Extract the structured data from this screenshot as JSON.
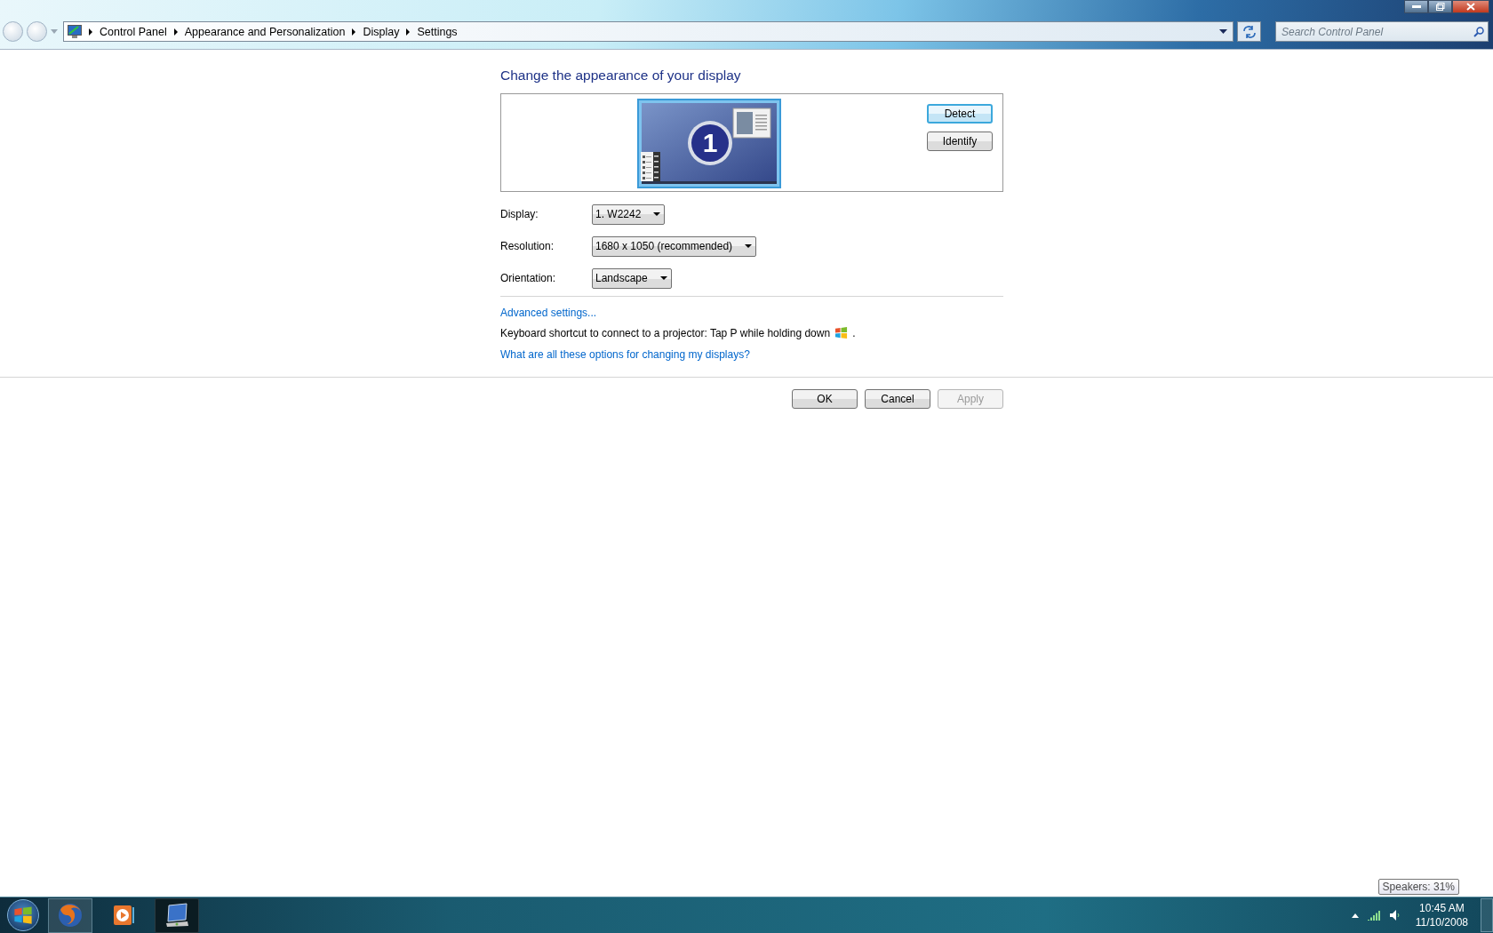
{
  "address_bar": {
    "breadcrumb": [
      "Control Panel",
      "Appearance and Personalization",
      "Display",
      "Settings"
    ],
    "search_placeholder": "Search Control Panel"
  },
  "heading": "Change the appearance of your display",
  "monitor": {
    "number": "1"
  },
  "monitor_buttons": [
    {
      "label": "Detect",
      "focused": true
    },
    {
      "label": "Identify",
      "focused": false
    }
  ],
  "fields": [
    {
      "label": "Display:",
      "value": "1. W2242"
    },
    {
      "label": "Resolution:",
      "value": "1680 x 1050 (recommended)"
    },
    {
      "label": "Orientation:",
      "value": "Landscape"
    }
  ],
  "advanced_link": "Advanced settings...",
  "shortcut_text": {
    "before": "Keyboard shortcut to connect to a projector: Tap P while holding down",
    "after": "."
  },
  "help_link": "What are all these options for changing my displays?",
  "dialog_buttons": [
    {
      "label": "OK",
      "disabled": false
    },
    {
      "label": "Cancel",
      "disabled": false
    },
    {
      "label": "Apply",
      "disabled": true
    }
  ],
  "taskbar": {
    "apps": [
      {
        "kind": "browser",
        "running": true,
        "selected": false
      },
      {
        "kind": "media",
        "running": false,
        "selected": false
      },
      {
        "kind": "display",
        "running": true,
        "selected": true
      }
    ],
    "tooltip": "Speakers: 31%",
    "time": "10:45 AM",
    "date": "11/10/2008"
  }
}
